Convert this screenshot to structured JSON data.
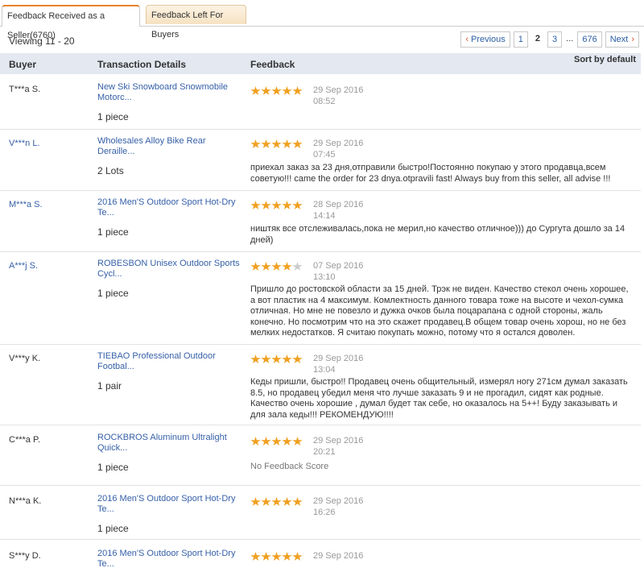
{
  "tabs": {
    "seller": "Feedback Received as a Seller(6760)",
    "buyers": "Feedback Left For Buyers"
  },
  "viewing": "Viewing 11 - 20",
  "pager": {
    "prev": "Previous",
    "p1": "1",
    "p2": "2",
    "p3": "3",
    "ellipsis": "...",
    "last": "676",
    "next": "Next"
  },
  "columns": {
    "buyer": "Buyer",
    "transaction": "Transaction Details",
    "feedback": "Feedback",
    "sort": "Sort by default"
  },
  "colors": {
    "accent": "#e8822a",
    "link": "#3660a8",
    "star": "#f0a021",
    "header_bg": "#e3e8f1"
  },
  "rows": [
    {
      "buyer": "T***a S.",
      "item": "New Ski Snowboard Snowmobile Motorc...",
      "qty": "1 piece",
      "rating": 5,
      "date": "29 Sep 2016",
      "time": "08:52",
      "feedback": ""
    },
    {
      "buyer": "V***n L.",
      "item": "Wholesales Alloy Bike Rear Deraille...",
      "qty": "2 Lots",
      "rating": 5,
      "date": "29 Sep 2016",
      "time": "07:45",
      "feedback": "приехал заказ за 23 дня,отправили быстро!Постоянно покупаю у этого продавца,всем советую!!! came the order for 23 dnya.otpravili fast! Always buy from this seller, all advise !!!"
    },
    {
      "buyer": "M***a S.",
      "item": "2016 Men'S Outdoor Sport Hot-Dry Te...",
      "qty": "1 piece",
      "rating": 5,
      "date": "28 Sep 2016",
      "time": "14:14",
      "feedback": "ништяк все отслеживалась,пока не мерил,но качество отличное))) до Сургута дошло за 14 дней)"
    },
    {
      "buyer": "A***j S.",
      "item": "ROBESBON Unisex Outdoor Sports Cycl...",
      "qty": "1 piece",
      "rating": 4,
      "date": "07 Sep 2016",
      "time": "13:10",
      "feedback": "Пришло до ростовской области за 15 дней. Трэк не виден. Качество стекол очень хорошее, а вот пластик на 4 максимум. Комлектность данного товара тоже на высоте и чехол-сумка отличная. Но мне не повезло и дужка очков была поцарапана с одной стороны, жаль конечно. Но посмотрим что на это скажет продавец.В общем товар очень хорош, но не без мелких недостатков. Я считаю покупать можно, потому что я остался доволен."
    },
    {
      "buyer": "V***y K.",
      "item": "TIEBAO Professional Outdoor Footbal...",
      "qty": "1 pair",
      "rating": 5,
      "date": "29 Sep 2016",
      "time": "13:04",
      "feedback": "Кеды пришли, быстро!! Продавец очень общительный, измерял ногу 271см думал заказать 8.5, но продавец убедил меня что лучше заказать 9 и не прогадил, сидят как родные. Качество очень хорошие , думал будет так себе, но оказалось на 5++! Буду заказывать и для зала кеды!!! РЕКОМЕНДУЮ!!!!"
    },
    {
      "buyer": "C***a P.",
      "item": "ROCKBROS Aluminum Ultralight Quick...",
      "qty": "1 piece",
      "rating": 5,
      "date": "29 Sep 2016",
      "time": "20:21",
      "feedback": "No Feedback Score"
    },
    {
      "buyer": "N***a K.",
      "item": "2016 Men'S Outdoor Sport Hot-Dry Te...",
      "qty": "1 piece",
      "rating": 5,
      "date": "29 Sep 2016",
      "time": "16:26",
      "feedback": ""
    },
    {
      "buyer": "S***y D.",
      "item": "2016 Men'S Outdoor Sport Hot-Dry Te...",
      "qty": "",
      "rating": 5,
      "date": "29 Sep 2016",
      "time": "",
      "feedback": ""
    }
  ]
}
